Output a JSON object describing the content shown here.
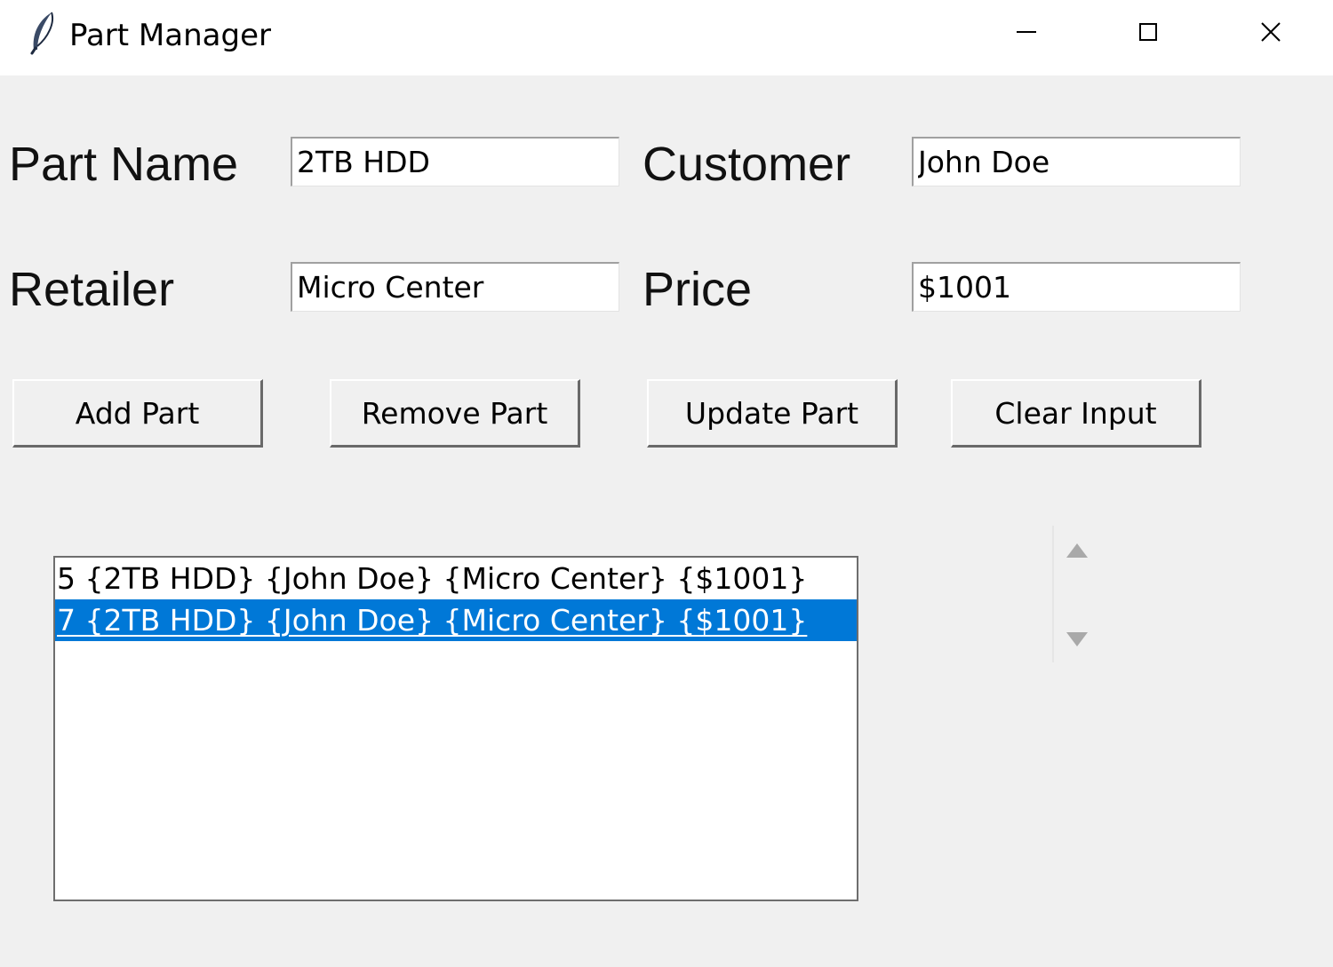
{
  "window": {
    "title": "Part Manager",
    "icon": "feather-icon",
    "controls": [
      "minimize-icon",
      "maximize-icon",
      "close-icon"
    ]
  },
  "form": {
    "part_name": {
      "label": "Part Name",
      "value": "2TB HDD"
    },
    "customer": {
      "label": "Customer",
      "value": "John Doe"
    },
    "retailer": {
      "label": "Retailer",
      "value": "Micro Center"
    },
    "price": {
      "label": "Price",
      "value": "$1001"
    }
  },
  "buttons": {
    "add": "Add Part",
    "remove": "Remove Part",
    "update": "Update Part",
    "clear": "Clear Input"
  },
  "list": {
    "items": [
      {
        "text": "5 {2TB HDD} {John Doe} {Micro Center} {$1001}",
        "selected": false
      },
      {
        "text": "7 {2TB HDD} {John Doe} {Micro Center} {$1001}",
        "selected": true
      }
    ],
    "selection_color": "#0078d7"
  },
  "scrollbar": {
    "icons": [
      "arrow-up-icon",
      "arrow-down-icon"
    ]
  }
}
